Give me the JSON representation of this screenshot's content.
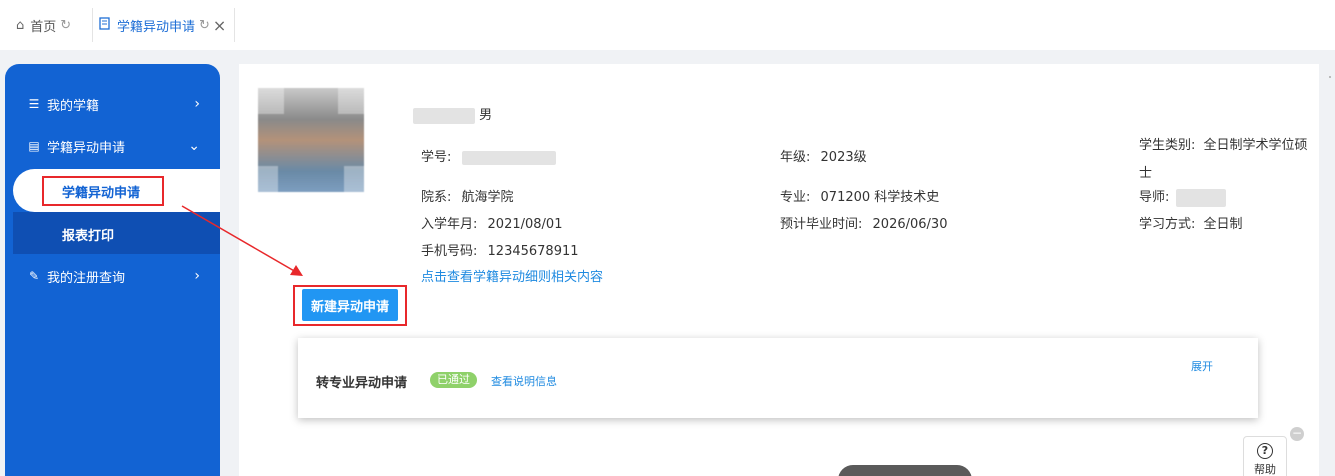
{
  "tabs": [
    {
      "label": "首页",
      "icon": "home-icon"
    },
    {
      "label": "学籍异动申请",
      "icon": "document-icon"
    }
  ],
  "sidebar": {
    "items": [
      {
        "label": "我的学籍",
        "icon": "list-icon",
        "chevron": "›"
      },
      {
        "label": "学籍异动申请",
        "icon": "document-icon",
        "chevron": "⌄"
      },
      {
        "label": "我的注册查询",
        "icon": "edit-document-icon",
        "chevron": "›"
      }
    ],
    "subitems": [
      {
        "label": "学籍异动申请"
      },
      {
        "label": "报表打印"
      }
    ]
  },
  "profile": {
    "gender": "男",
    "student_no_label": "学号:",
    "grade_label": "年级:",
    "grade_value": "2023级",
    "student_type_label": "学生类别:",
    "student_type_value": "全日制学术学位硕士",
    "department_label": "院系:",
    "department_value": "航海学院",
    "major_label": "专业:",
    "major_value": "071200 科学技术史",
    "advisor_label": "导师:",
    "enroll_label": "入学年月:",
    "enroll_value": "2021/08/01",
    "graduate_label": "预计毕业时间:",
    "graduate_value": "2026/06/30",
    "study_mode_label": "学习方式:",
    "study_mode_value": "全日制",
    "phone_label": "手机号码:",
    "phone_value": "12345678911",
    "rules_link": "点击查看学籍异动细则相关内容"
  },
  "actions": {
    "new_application": "新建异动申请"
  },
  "panel": {
    "title": "转专业异动申请",
    "status": "已通过",
    "detail_link": "查看说明信息",
    "expand": "展开"
  },
  "help": {
    "label": "帮助"
  },
  "colors": {
    "sidebar": "#1263d3",
    "primary_button": "#2196f3",
    "link": "#1f8ae0",
    "badge": "#8fd16a",
    "highlight": "#e8282b"
  }
}
